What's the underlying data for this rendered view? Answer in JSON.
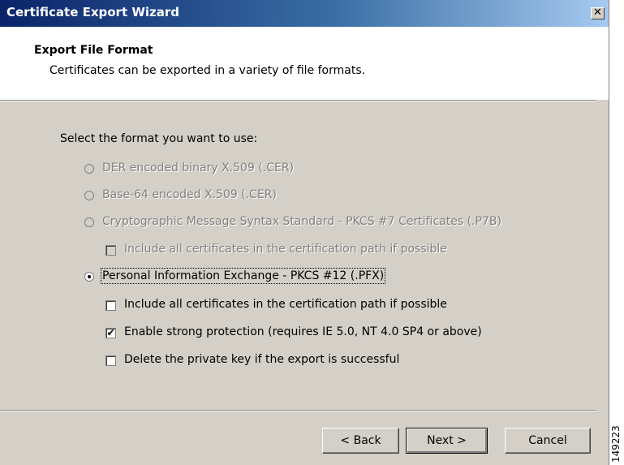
{
  "window": {
    "title": "Certificate Export Wizard",
    "close_label": "✕"
  },
  "header": {
    "title": "Export File Format",
    "subtitle": "Certificates can be exported in a variety of file formats."
  },
  "prompt": "Select the format you want to use:",
  "options": {
    "der": "DER encoded binary X.509 (.CER)",
    "base64": "Base-64 encoded X.509 (.CER)",
    "pkcs7": "Cryptographic Message Syntax Standard - PKCS #7 Certificates (.P7B)",
    "pkcs7_include": "Include all certificates in the certification path if possible",
    "pfx": "Personal Information Exchange - PKCS #12 (.PFX)",
    "pfx_include": "Include all certificates in the certification path if possible",
    "pfx_strong": "Enable strong protection (requires IE 5.0, NT 4.0 SP4 or above)",
    "pfx_delete_key": "Delete the private key if the export is successful"
  },
  "state": {
    "selected_format": "pfx",
    "pkcs7_include": false,
    "pfx_include": false,
    "pfx_strong": true,
    "pfx_delete_key": false
  },
  "buttons": {
    "back": "< Back",
    "next": "Next >",
    "cancel": "Cancel"
  },
  "figure_id": "149223",
  "icons": {
    "close": "close-icon",
    "check": "checkmark-icon",
    "radio_dot": "radio-dot-icon"
  },
  "colors": {
    "titlebar_start": "#0a246a",
    "titlebar_end": "#a6caf0",
    "dialog_bg": "#d4d0c8",
    "disabled_text": "#808080"
  }
}
